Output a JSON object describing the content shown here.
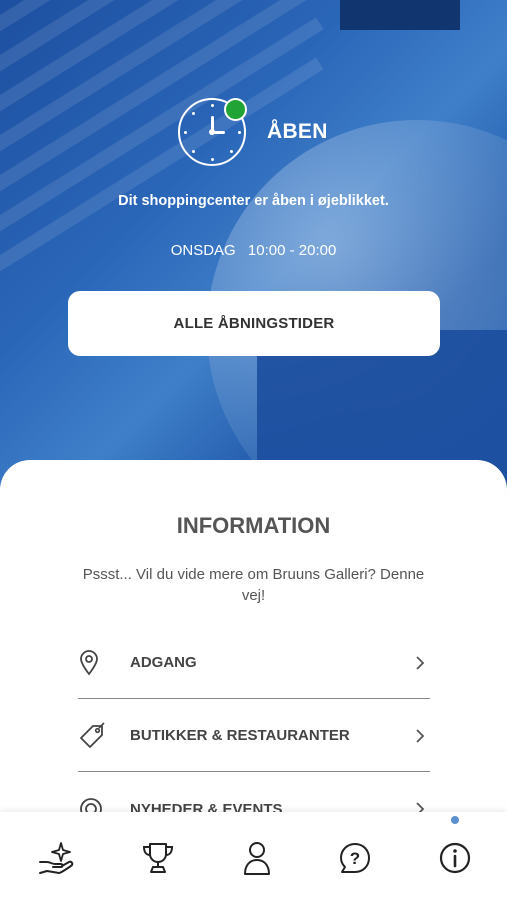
{
  "hero": {
    "status_label": "ÅBEN",
    "status_text": "Dit shoppingcenter er åben i øjeblikket.",
    "day": "ONSDAG",
    "hours": "10:00 - 20:00",
    "all_hours_button": "ALLE ÅBNINGSTIDER",
    "status_color": "#21a336"
  },
  "info": {
    "title": "INFORMATION",
    "subtitle": "Pssst... Vil du vide mere om Bruuns Galleri? Denne vej!",
    "items": [
      {
        "label": "ADGANG",
        "icon": "location-pin-icon"
      },
      {
        "label": "BUTIKKER & RESTAURANTER",
        "icon": "tag-icon"
      },
      {
        "label": "NYHEDER & EVENTS",
        "icon": "target-icon"
      }
    ]
  },
  "nav": {
    "items": [
      {
        "icon": "hand-sparkle-icon"
      },
      {
        "icon": "trophy-icon"
      },
      {
        "icon": "user-icon"
      },
      {
        "icon": "help-bubble-icon"
      },
      {
        "icon": "info-icon",
        "active": true
      }
    ],
    "accent": "#5b8fd0"
  }
}
